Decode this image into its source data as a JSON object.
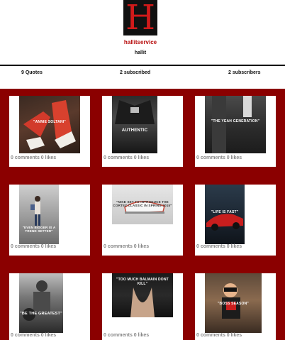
{
  "profile": {
    "logo_letter": "H",
    "username": "hallitservice",
    "handle": "hallit"
  },
  "stats": {
    "quotes": "9 Quotes",
    "subscribed": "2 subscribed",
    "subscribers": "2 subscribers"
  },
  "quotes": [
    {
      "caption": "\"ANNIE SOLTANI\"",
      "meta": "0 comments 0 likes"
    },
    {
      "caption": "AUTHENTIC",
      "meta": "0 comments 0 likes"
    },
    {
      "caption": "\"THE YEAH GENERATION\"",
      "meta": "0 comments 0 likes"
    },
    {
      "caption": "\"EVEN BIGGER IS A TREND SETTER\"",
      "meta": "0 comments 0 likes"
    },
    {
      "caption": "\"NIKE SET TO INTRODUCE THE CORTEZ CLASSIC IN SPRING 2015\"",
      "meta": "0 comments 0 likes"
    },
    {
      "caption": "\"LIFE IS FAST\"",
      "meta": "0 comments 0 likes"
    },
    {
      "caption": "\"BE THE GREATEST\"",
      "meta": "0 comments 0 likes"
    },
    {
      "caption": "\"TOO MUCH BALMAIN DONT KILL\"",
      "meta": "0 comments 0 likes"
    },
    {
      "caption": "\"BOSS SEASON\"",
      "meta": "0 comments 0 likes"
    }
  ]
}
